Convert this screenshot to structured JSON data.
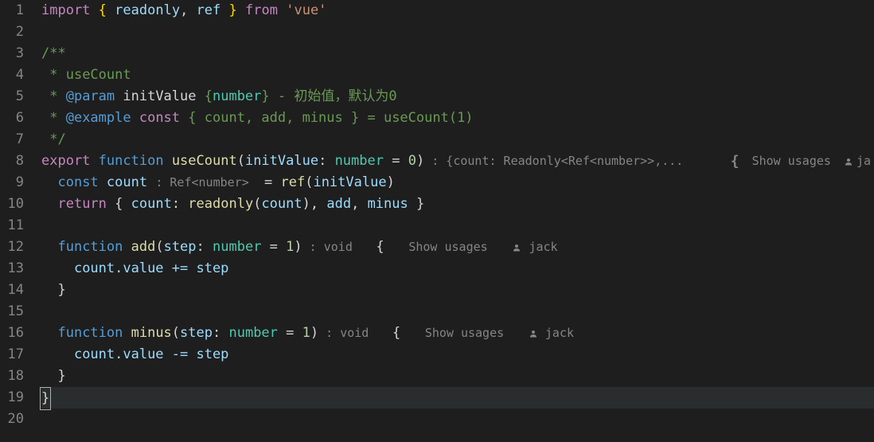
{
  "gutter": {
    "start": 1,
    "end": 20
  },
  "code": {
    "l1": {
      "import": "import",
      "lb": "{",
      "readonly": "readonly",
      "comma": ",",
      "ref": "ref",
      "rb": "}",
      "from": "from",
      "str": "'vue'"
    },
    "l3": {
      "open": "/**"
    },
    "l4": {
      "star": " * ",
      "text": "useCount"
    },
    "l5": {
      "star": " * ",
      "tag": "@param",
      "name": " initValue ",
      "lb": "{",
      "type": "number",
      "rb": "}",
      "rest": " - 初始值，默认为0"
    },
    "l6": {
      "star": " * ",
      "tag": "@example",
      "const": " const ",
      "lb": "{ ",
      "ids": "count, add, minus",
      "rb": " }",
      "eq": " = ",
      "call": "useCount(1)"
    },
    "l7": {
      "close": " */"
    },
    "l8": {
      "export": "export",
      "function": "function",
      "name": "useCount",
      "lp": "(",
      "param": "initValue",
      "colon": ": ",
      "type": "number",
      "eq": " = ",
      "def": "0",
      "rp": ")",
      "inlay": " : {count: Readonly<Ref<number>>,...",
      "brace": "{",
      "su": "Show usages",
      "author": "ja"
    },
    "l9": {
      "indent": "  ",
      "const": "const",
      "name": " count ",
      "inlay": ": Ref<number> ",
      "eq": " = ",
      "ref": "ref",
      "lp": "(",
      "arg": "initValue",
      "rp": ")"
    },
    "l10": {
      "indent": "  ",
      "return": "return",
      "lb": " { ",
      "count": "count",
      "colon": ": ",
      "readonly": "readonly",
      "lp": "(",
      "arg": "count",
      "rp": ")",
      "c1": ", ",
      "add": "add",
      "c2": ", ",
      "minus": "minus",
      "rb": " }"
    },
    "l12": {
      "indent": "  ",
      "function": "function",
      "name": " add",
      "lp": "(",
      "param": "step",
      "colon": ": ",
      "type": "number",
      "eq": " = ",
      "def": "1",
      "rp": ")",
      "inlay": " : void ",
      "brace": "  {",
      "su": "Show usages",
      "author": "jack"
    },
    "l13": {
      "indent": "    ",
      "body": "count.value += step"
    },
    "l14": {
      "indent": "  ",
      "brace": "}"
    },
    "l16": {
      "indent": "  ",
      "function": "function",
      "name": " minus",
      "lp": "(",
      "param": "step",
      "colon": ": ",
      "type": "number",
      "eq": " = ",
      "def": "1",
      "rp": ")",
      "inlay": " : void ",
      "brace": "  {",
      "su": "Show usages",
      "author": "jack"
    },
    "l17": {
      "indent": "    ",
      "body": "count.value -= step"
    },
    "l18": {
      "indent": "  ",
      "brace": "}"
    },
    "l19": {
      "brace": "}"
    }
  }
}
